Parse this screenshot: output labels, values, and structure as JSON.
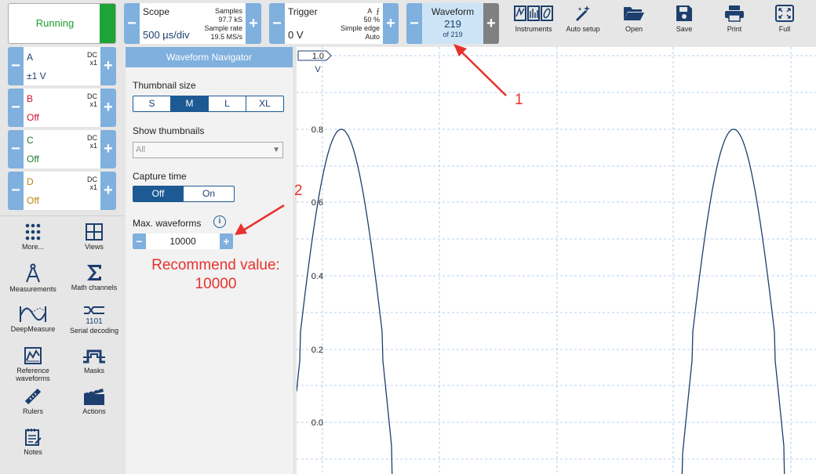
{
  "toolbar": {
    "run_label": "Running",
    "scope": {
      "title": "Scope",
      "timebase": "500 µs/div",
      "samples_label": "Samples",
      "samples_value": "97.7 kS",
      "rate_label": "Sample rate",
      "rate_value": "19.5 MS/s"
    },
    "trigger": {
      "title": "Trigger",
      "level": "0 V",
      "channel": "A",
      "percent": "50 %",
      "mode": "Simple edge",
      "auto": "Auto"
    },
    "waveform": {
      "title": "Waveform",
      "current": "219",
      "of_label": "of 219"
    },
    "tools": [
      "Instruments",
      "Auto setup",
      "Open",
      "Save",
      "Print",
      "Full"
    ]
  },
  "channels": [
    {
      "name": "A",
      "coupling": "DC",
      "probe": "x1",
      "range": "±1 V",
      "color": "#1d3f6e"
    },
    {
      "name": "B",
      "coupling": "DC",
      "probe": "x1",
      "range": "Off",
      "color": "#c8102e"
    },
    {
      "name": "C",
      "coupling": "DC",
      "probe": "x1",
      "range": "Off",
      "color": "#1c7a2e"
    },
    {
      "name": "D",
      "coupling": "DC",
      "probe": "x1",
      "range": "Off",
      "color": "#b8860b"
    }
  ],
  "sidebar": {
    "items": [
      {
        "label": "More...",
        "icon": "dots-grid-icon"
      },
      {
        "label": "Views",
        "icon": "views-grid-icon"
      },
      {
        "label": "Measurements",
        "icon": "compass-icon"
      },
      {
        "label": "Math channels",
        "icon": "sigma-icon"
      },
      {
        "label": "DeepMeasure",
        "icon": "deepmeasure-icon"
      },
      {
        "label": "Serial decoding",
        "icon": "serial-decoding-icon"
      },
      {
        "label": "Reference waveforms",
        "icon": "reference-waveform-icon"
      },
      {
        "label": "Masks",
        "icon": "masks-icon"
      },
      {
        "label": "Rulers",
        "icon": "ruler-icon"
      },
      {
        "label": "Actions",
        "icon": "clapper-icon"
      },
      {
        "label": "Notes",
        "icon": "notes-icon"
      }
    ]
  },
  "navigator": {
    "title": "Waveform Navigator",
    "thumbnail_size_label": "Thumbnail size",
    "thumbnail_sizes": [
      "S",
      "M",
      "L",
      "XL"
    ],
    "thumbnail_selected": "M",
    "show_thumbnails_label": "Show thumbnails",
    "show_thumbnails_value": "All",
    "capture_time_label": "Capture time",
    "capture_time_options": [
      "Off",
      "On"
    ],
    "capture_time_selected": "Off",
    "max_waveforms_label": "Max. waveforms",
    "max_waveforms_value": "10000"
  },
  "plot": {
    "unit": "V",
    "range_label": "1.0",
    "y_ticks": [
      "0.8",
      "0.6",
      "0.4",
      "0.2",
      "0.0"
    ],
    "trace_color": "#1d3f6e",
    "grid_color": "#9cc3e6"
  },
  "annotations": {
    "arrow1_label": "1",
    "arrow2_label": "2",
    "recommend_line1": "Recommend value:",
    "recommend_line2": "10000",
    "color": "#e6322d"
  }
}
